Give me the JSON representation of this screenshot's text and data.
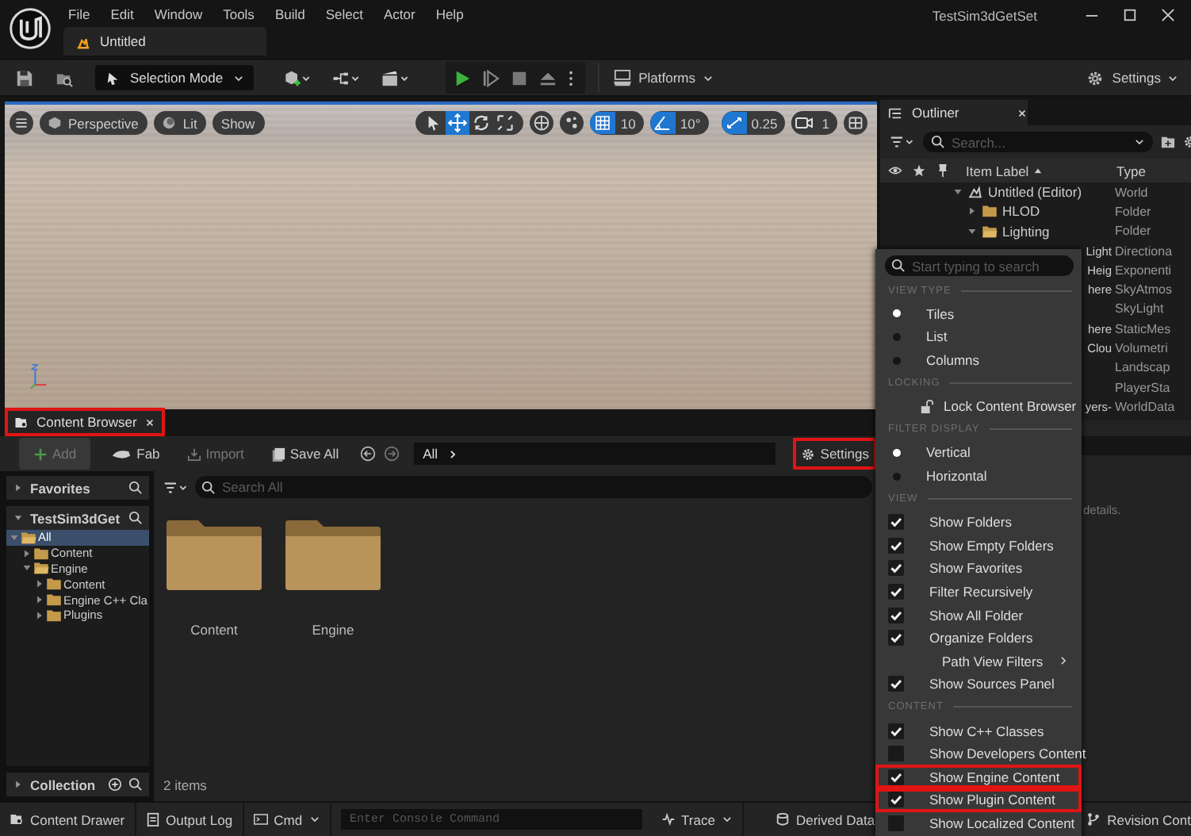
{
  "window": {
    "title": "TestSim3dGetSet",
    "menu": [
      "File",
      "Edit",
      "Window",
      "Tools",
      "Build",
      "Select",
      "Actor",
      "Help"
    ],
    "level_tab": "Untitled"
  },
  "toolbar": {
    "mode": "Selection Mode",
    "platforms": "Platforms",
    "settings": "Settings"
  },
  "viewport": {
    "view": "Perspective",
    "lighting": "Lit",
    "show": "Show",
    "tools": [
      {
        "kind": "select",
        "selected": false
      },
      {
        "kind": "move",
        "selected": true
      },
      {
        "kind": "rotate",
        "selected": false
      },
      {
        "kind": "scale",
        "selected": false
      }
    ],
    "snaps": [
      {
        "kind": "grid",
        "on": true,
        "value": "10"
      },
      {
        "kind": "angle",
        "on": true,
        "value": "10°"
      },
      {
        "kind": "scale",
        "on": true,
        "value": "0.25"
      }
    ],
    "camera_speed": "1"
  },
  "outliner": {
    "title": "Outliner",
    "search": {
      "placeholder": "Search..."
    },
    "columns": [
      "Item Label",
      "Type"
    ],
    "rows": [
      {
        "label": "Untitled (Editor)",
        "type": "World",
        "kind": "level",
        "expanded": true,
        "children": [
          {
            "label": "HLOD",
            "type": "Folder",
            "kind": "folder",
            "expanded": false
          },
          {
            "label": "Lighting",
            "type": "Folder",
            "kind": "folder",
            "expanded": true,
            "children": [
              {
                "label": "Light",
                "type": "Directiona",
                "kind": "clipped"
              },
              {
                "label": "Heig",
                "type": "Exponenti",
                "kind": "clipped"
              },
              {
                "label": "here",
                "type": "SkyAtmos",
                "kind": "clipped"
              },
              {
                "type": "SkyLight",
                "kind": "clipped"
              }
            ]
          },
          {
            "label": "here",
            "type": "StaticMes",
            "kind": "clipped"
          },
          {
            "label": "Clou",
            "type": "Volumetri",
            "kind": "clipped"
          },
          {
            "type": "Landscap",
            "kind": "clipped"
          },
          {
            "type": "PlayerSta",
            "kind": "clipped"
          },
          {
            "label": "yers-",
            "type": "WorldData",
            "kind": "clipped"
          }
        ]
      }
    ]
  },
  "details": {
    "text": "details."
  },
  "content_browser": {
    "tab": {
      "label": "Content Browser",
      "highlighted": true
    },
    "toolbar": {
      "add": "Add",
      "fab": "Fab",
      "import": "Import",
      "save_all": "Save All",
      "path": "All",
      "settings": {
        "label": "Settings",
        "highlighted": true
      }
    },
    "sidebar": {
      "favorites": {
        "label": "Favorites",
        "expanded": false
      },
      "project": {
        "label": "TestSim3dGet",
        "expanded": true
      },
      "tree": [
        {
          "label": "All",
          "expanded": true,
          "selected": true,
          "children": [
            {
              "label": "Content",
              "expanded": false,
              "selected": false
            },
            {
              "label": "Engine",
              "expanded": true,
              "selected": false,
              "children": [
                {
                  "label": "Content",
                  "expanded": false,
                  "selected": false
                },
                {
                  "label": "Engine C++ Cla",
                  "expanded": false,
                  "selected": false
                },
                {
                  "label": "Plugins",
                  "expanded": false,
                  "selected": false
                }
              ]
            }
          ]
        }
      ],
      "collection": {
        "label": "Collection",
        "expanded": false
      }
    },
    "search": {
      "placeholder": "Search All"
    },
    "items": [
      {
        "label": "Content"
      },
      {
        "label": "Engine"
      }
    ],
    "count": "2 items"
  },
  "settings_menu": {
    "search": {
      "placeholder": "Start typing to search"
    },
    "items": [
      {
        "kind": "header",
        "label": "VIEW TYPE"
      },
      {
        "kind": "radio",
        "label": "Tiles",
        "selected": true
      },
      {
        "kind": "radio",
        "label": "List",
        "selected": false
      },
      {
        "kind": "radio",
        "label": "Columns",
        "selected": false
      },
      {
        "kind": "header",
        "label": "LOCKING"
      },
      {
        "kind": "action",
        "label": "Lock Content Browser"
      },
      {
        "kind": "header",
        "label": "FILTER DISPLAY"
      },
      {
        "kind": "radio",
        "label": "Vertical",
        "selected": true
      },
      {
        "kind": "radio",
        "label": "Horizontal",
        "selected": false
      },
      {
        "kind": "header",
        "label": "VIEW"
      },
      {
        "kind": "check",
        "label": "Show Folders",
        "checked": true,
        "highlighted": false
      },
      {
        "kind": "check",
        "label": "Show Empty Folders",
        "checked": true,
        "highlighted": false
      },
      {
        "kind": "check",
        "label": "Show Favorites",
        "checked": true,
        "highlighted": false
      },
      {
        "kind": "check",
        "label": "Filter Recursively",
        "checked": true,
        "highlighted": false
      },
      {
        "kind": "check",
        "label": "Show All Folder",
        "checked": true,
        "highlighted": false
      },
      {
        "kind": "check",
        "label": "Organize Folders",
        "checked": true,
        "highlighted": false
      },
      {
        "kind": "submenu",
        "label": "Path View Filters"
      },
      {
        "kind": "check",
        "label": "Show Sources Panel",
        "checked": true,
        "highlighted": false
      },
      {
        "kind": "header",
        "label": "CONTENT"
      },
      {
        "kind": "check",
        "label": "Show C++ Classes",
        "checked": true,
        "highlighted": false
      },
      {
        "kind": "check",
        "label": "Show Developers Content",
        "checked": false,
        "highlighted": false
      },
      {
        "kind": "check",
        "label": "Show Engine Content",
        "checked": true,
        "highlighted": true
      },
      {
        "kind": "check",
        "label": "Show Plugin Content",
        "checked": true,
        "highlighted": true
      },
      {
        "kind": "check",
        "label": "Show Localized Content",
        "checked": false,
        "highlighted": false
      }
    ]
  },
  "status_bar": {
    "content_drawer": "Content Drawer",
    "output_log": "Output Log",
    "cmd": "Cmd",
    "console": {
      "placeholder": "Enter Console Command"
    },
    "trace": "Trace",
    "derived_data": "Derived Data",
    "revision_control": "Revision Cont"
  }
}
